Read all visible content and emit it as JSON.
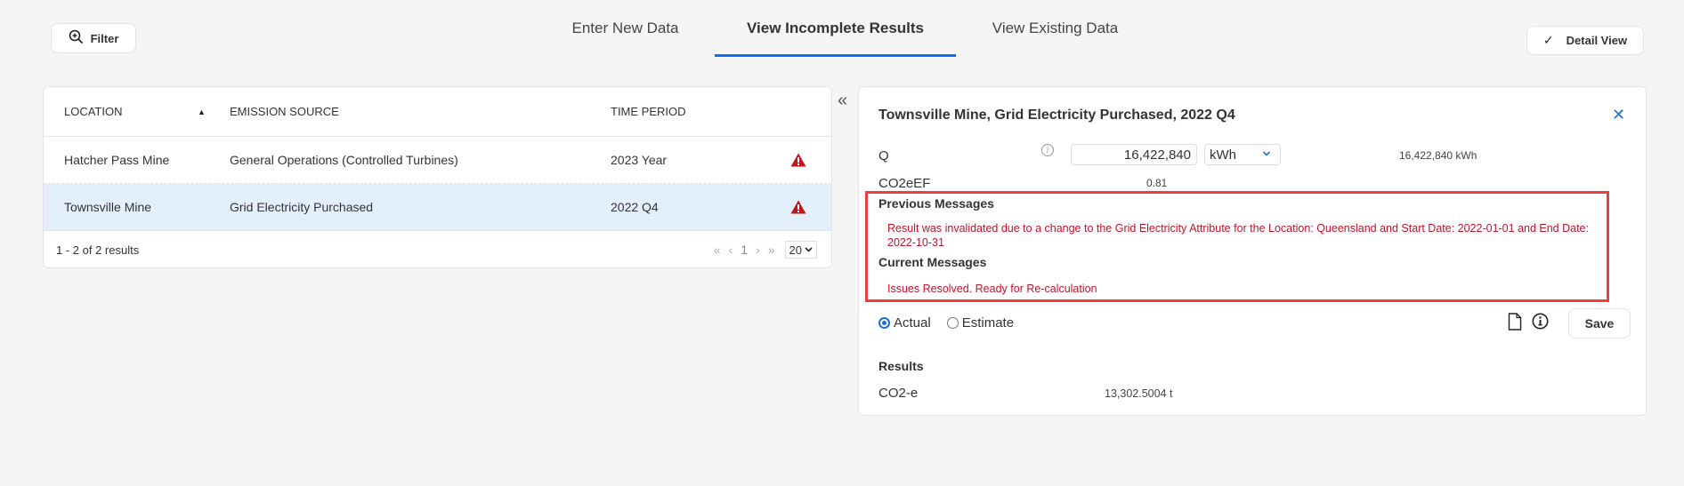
{
  "toolbar": {
    "filter_label": "Filter",
    "filter_icon": "zoom-in-icon",
    "detail_view_label": "Detail View",
    "detail_view_icon": "checkmark-icon",
    "detail_view_check": "✓"
  },
  "tabs": [
    {
      "label": "Enter New Data",
      "active": false
    },
    {
      "label": "View Incomplete Results",
      "active": true
    },
    {
      "label": "View Existing Data",
      "active": false
    }
  ],
  "accent_color": "#0a6ef0",
  "table": {
    "columns": [
      "LOCATION",
      "EMISSION SOURCE",
      "TIME PERIOD"
    ],
    "sort_indicator": "▲",
    "rows": [
      {
        "location": "Hatcher Pass Mine",
        "source": "General Operations (Controlled Turbines)",
        "period": "2023 Year",
        "status_icon": "warning-icon",
        "selected": false
      },
      {
        "location": "Townsville Mine",
        "source": "Grid Electricity Purchased",
        "period": "2022 Q4",
        "status_icon": "warning-icon",
        "selected": true
      }
    ],
    "footer": {
      "count_text": "1 - 2 of 2 results",
      "first": "«",
      "prev": "‹",
      "page": "1",
      "next": "›",
      "last": "»",
      "page_size": "20"
    }
  },
  "collapse_glyph": "«",
  "detail": {
    "title": "Townsville Mine, Grid Electricity Purchased, 2022 Q4",
    "close_glyph": "✕",
    "q_label": "Q",
    "q_value": "16,422,840",
    "q_unit": "kWh",
    "q_readout": "16,422,840  kWh",
    "co2eef_label": "CO2eEF",
    "co2eef_value": "0.81",
    "previous_messages_heading": "Previous Messages",
    "previous_message": "Result was invalidated due to a change to the Grid Electricity Attribute for the Location: Queensland and Start Date: 2022-01-01 and End Date: 2022-10-31",
    "current_messages_heading": "Current Messages",
    "current_message": "Issues Resolved. Ready for Re-calculation",
    "radio_actual": "Actual",
    "radio_estimate": "Estimate",
    "selected_radio": "Actual",
    "save_label": "Save",
    "results_heading": "Results",
    "co2e_label": "CO2-e",
    "co2e_value": "13,302.5004 t",
    "highlight_color": "#ef3e42",
    "message_color": "#c0142c"
  }
}
